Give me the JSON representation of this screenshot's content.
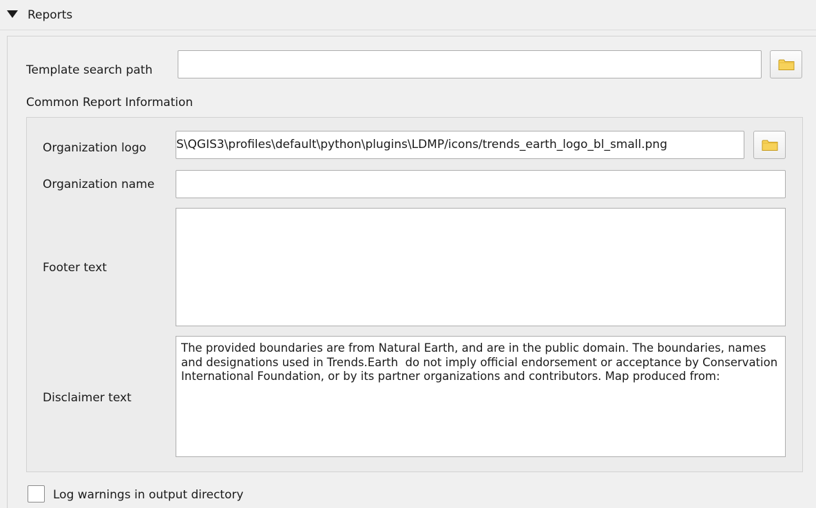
{
  "section": {
    "title": "Reports"
  },
  "template_search_path": {
    "label": "Template search path",
    "value": ""
  },
  "common_report_info": {
    "title": "Common Report Information",
    "organization_logo": {
      "label": "Organization logo",
      "value": "S\\QGIS3\\profiles\\default\\python\\plugins\\LDMP/icons/trends_earth_logo_bl_small.png"
    },
    "organization_name": {
      "label": "Organization name",
      "value": ""
    },
    "footer_text": {
      "label": "Footer text",
      "value": ""
    },
    "disclaimer_text": {
      "label": "Disclaimer text",
      "value": "The provided boundaries are from Natural Earth, and are in the public domain. The boundaries, names and designations used in Trends.Earth  do not imply official endorsement or acceptance by Conservation International Foundation, or by its partner organizations and contributors. Map produced from:"
    }
  },
  "log_warnings": {
    "label": "Log warnings in output directory",
    "checked": false
  },
  "colors": {
    "folder_fill": "#f7d25a",
    "folder_stroke": "#c69a1c"
  },
  "icons": {
    "collapse": "triangle-down-icon",
    "browse": "folder-icon"
  }
}
